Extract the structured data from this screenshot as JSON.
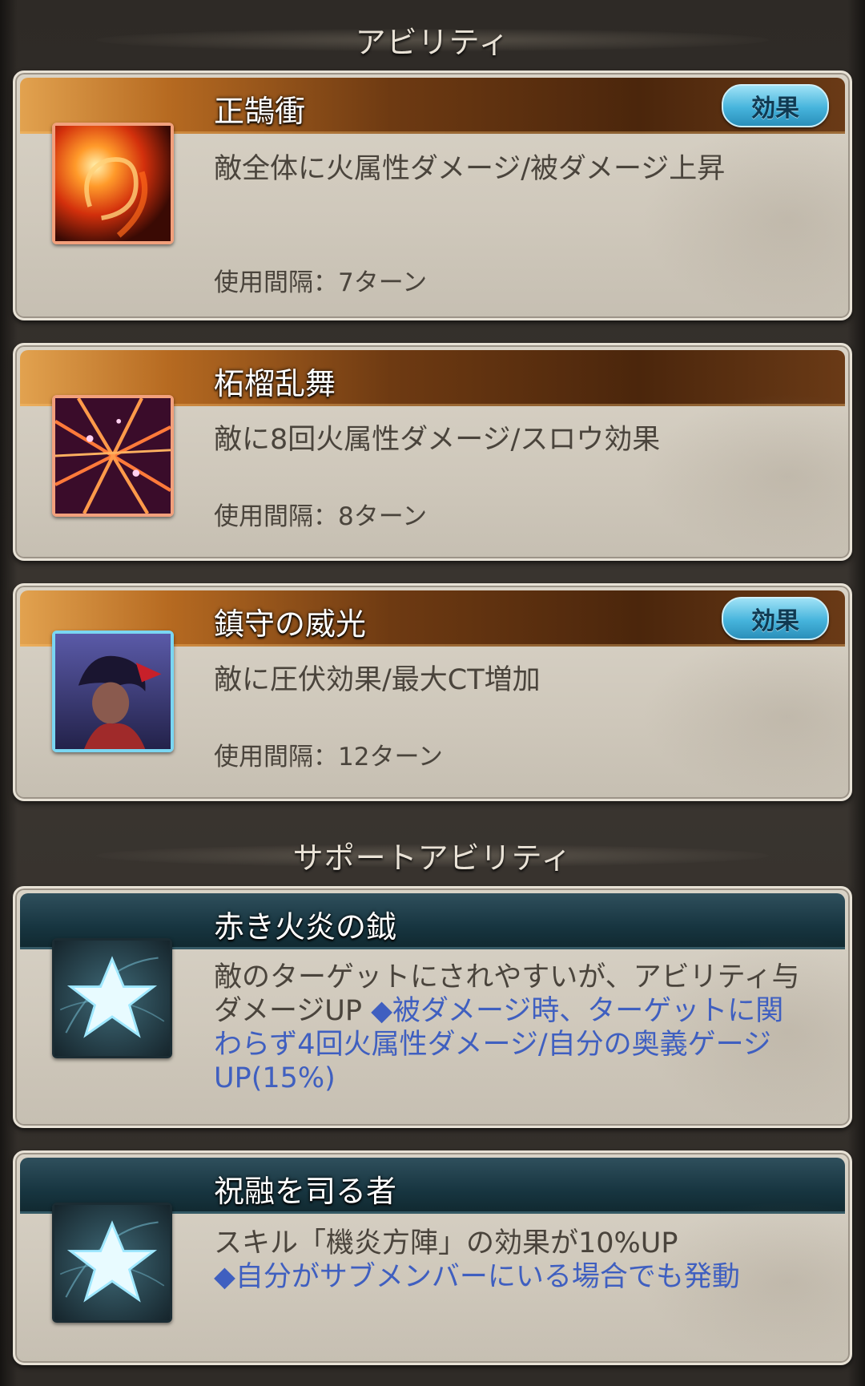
{
  "sections": {
    "ability_title": "アビリティ",
    "support_title": "サポートアビリティ"
  },
  "abilities": [
    {
      "name": "正鵠衝",
      "effect_label": "効果",
      "description": "敵全体に火属性ダメージ/被ダメージ上昇",
      "cooldown": "使用間隔：7ターン",
      "icon": "fire-orb-icon"
    },
    {
      "name": "柘榴乱舞",
      "description": "敵に8回火属性ダメージ/スロウ効果",
      "cooldown": "使用間隔：8ターン",
      "icon": "crossing-slashes-icon"
    },
    {
      "name": "鎮守の威光",
      "effect_label": "効果",
      "description": "敵に圧伏効果/最大CT増加",
      "cooldown": "使用間隔：12ターン",
      "icon": "character-portrait-icon"
    }
  ],
  "support_abilities": [
    {
      "name": "赤き火炎の鉞",
      "description": "敵のターゲットにされやすいが、アビリティ与ダメージUP",
      "extra": "◆被ダメージ時、ターゲットに関わらず4回火属性ダメージ/自分の奥義ゲージUP(15%)",
      "icon": "star-icon"
    },
    {
      "name": "祝融を司る者",
      "description": "スキル「機炎方陣」の効果が10%UP",
      "extra": "◆自分がサブメンバーにいる場合でも発動",
      "icon": "star-icon"
    }
  ],
  "colors": {
    "ability_bar": "#6e3a12",
    "support_bar": "#173540",
    "effect_button": "#46b4dc",
    "support_extra_text": "#3f5fc0"
  }
}
